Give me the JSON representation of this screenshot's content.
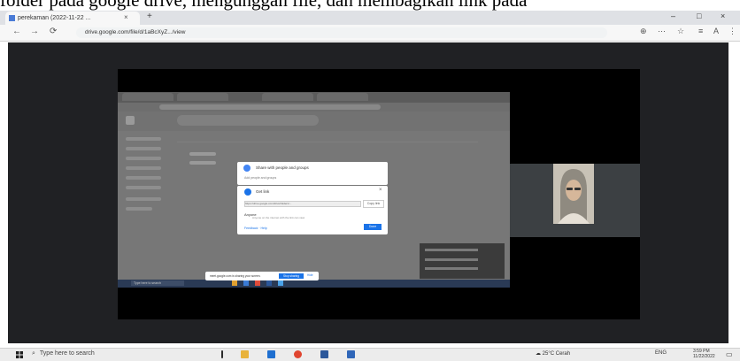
{
  "caption": "folder pada google drive, mengunggah file, dan membagikan link pada",
  "browser": {
    "tab_title": "perekaman (2022-11-22 ...",
    "tab_close": "×",
    "new_tab": "+",
    "win_controls": [
      "–",
      "□",
      "×"
    ],
    "nav": [
      "←",
      "→",
      "⟳"
    ],
    "url": "drive.google.com/file/d/1aBcXyZ.../view",
    "toolbar_icons": [
      "⊕",
      "⋯",
      "☆",
      "≡",
      "A",
      "⋮"
    ]
  },
  "meeting": {
    "shared_screen": {
      "dialog_share": {
        "title": "Share with people and groups",
        "subtitle": "Add people and groups"
      },
      "dialog_link": {
        "title": "Get link",
        "close": "×",
        "input_text": "https://drive.google.com/drive/folders/...",
        "copy_btn": "Copy link",
        "person": "Anyone",
        "person_sub": "Anyone on the internet with the link can view",
        "footer": "Feedback · Help",
        "done": "Done"
      },
      "share_bar": {
        "text": "meet.google.com is sharing your screen.",
        "stop": "Stop sharing",
        "hide": "Hide"
      },
      "inner_taskbar_search": "Type here to search"
    }
  },
  "taskbar": {
    "search_placeholder": "Type here to search",
    "tray_weather": "☁ 25°C Cerah",
    "tray_lang": "ENG",
    "time": "3:59 PM",
    "date": "11/22/2022"
  },
  "colors": {
    "accent": "#1a73e8",
    "meeting_bg": "#202124"
  }
}
